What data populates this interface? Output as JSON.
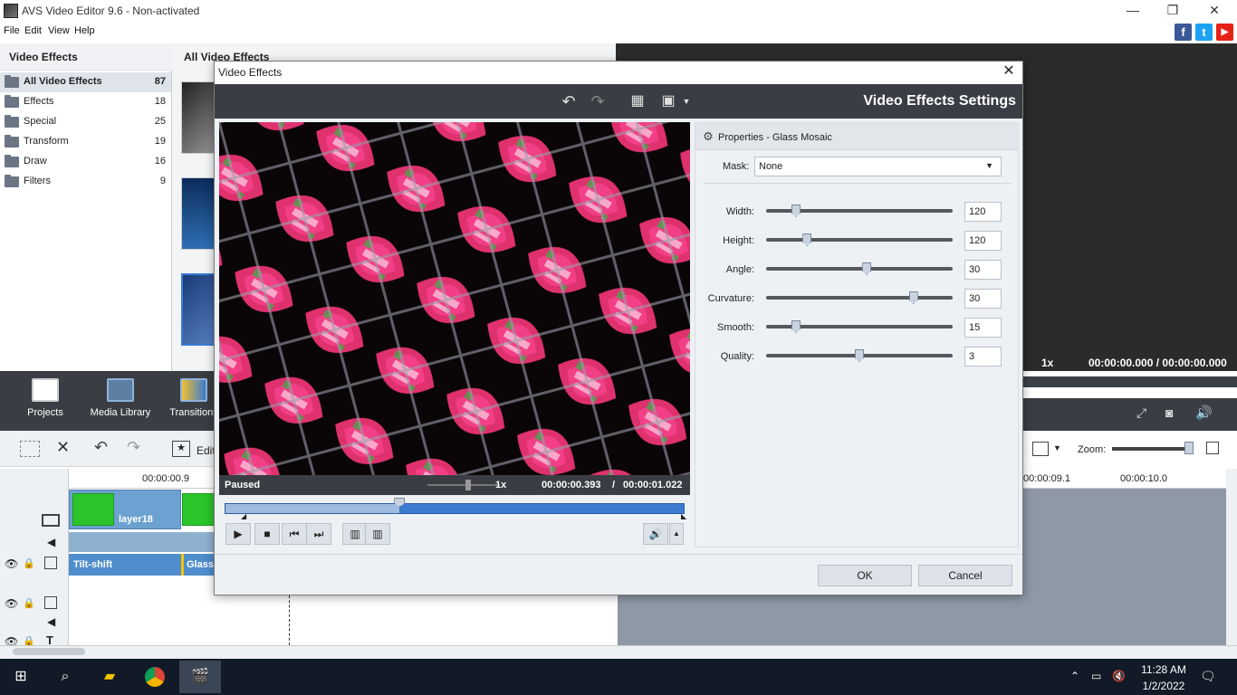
{
  "window": {
    "title": "AVS Video Editor 9.6 - Non-activated",
    "min": "—",
    "max": "❐",
    "close": "✕"
  },
  "menu": [
    "File",
    "Edit",
    "View",
    "Help"
  ],
  "social": {
    "facebook": "f",
    "twitter": "t",
    "youtube": "▶"
  },
  "left_panel": {
    "title": "Video Effects",
    "categories": [
      {
        "label": "All Video Effects",
        "count": "87"
      },
      {
        "label": "Effects",
        "count": "18"
      },
      {
        "label": "Special",
        "count": "25"
      },
      {
        "label": "Transform",
        "count": "19"
      },
      {
        "label": "Draw",
        "count": "16"
      },
      {
        "label": "Filters",
        "count": "9"
      }
    ]
  },
  "thumbs_title": "All Video Effects",
  "main_toolbar": {
    "projects": "Projects",
    "media_library": "Media Library",
    "transitions": "Transitions"
  },
  "edit_label": "Edit",
  "timeline": {
    "time1": "00:00:00.9",
    "time2": "00:00:09.1",
    "time3": "00:00:10.0",
    "clip_label": "layer18",
    "fx1": "Tilt-shift",
    "fx2": "Glass"
  },
  "preview": {
    "speed": "1x",
    "time": "00:00:00.000 / 00:00:00.000",
    "zoom_label": "Zoom:"
  },
  "dialog": {
    "title": "Video Effects",
    "close": "✕",
    "header": "Video Effects Settings",
    "status": "Paused",
    "speed": "1x",
    "time_current": "00:00:00.393",
    "time_sep": "/",
    "time_total": "00:00:01.022",
    "properties_label": "Properties - Glass Mosaic",
    "mask_label": "Mask:",
    "mask_value": "None",
    "sliders": [
      {
        "label": "Width:",
        "value": "120",
        "level": 0.16
      },
      {
        "label": "Height:",
        "value": "120",
        "level": 0.22
      },
      {
        "label": "Angle:",
        "value": "30",
        "level": 0.54
      },
      {
        "label": "Curvature:",
        "value": "30",
        "level": 0.79
      },
      {
        "label": "Smooth:",
        "value": "15",
        "level": 0.16
      },
      {
        "label": "Quality:",
        "value": "3",
        "level": 0.5
      }
    ],
    "seek_level": 0.38,
    "ok": "OK",
    "cancel": "Cancel"
  },
  "taskbar": {
    "time": "11:28 AM",
    "date": "1/2/2022"
  }
}
